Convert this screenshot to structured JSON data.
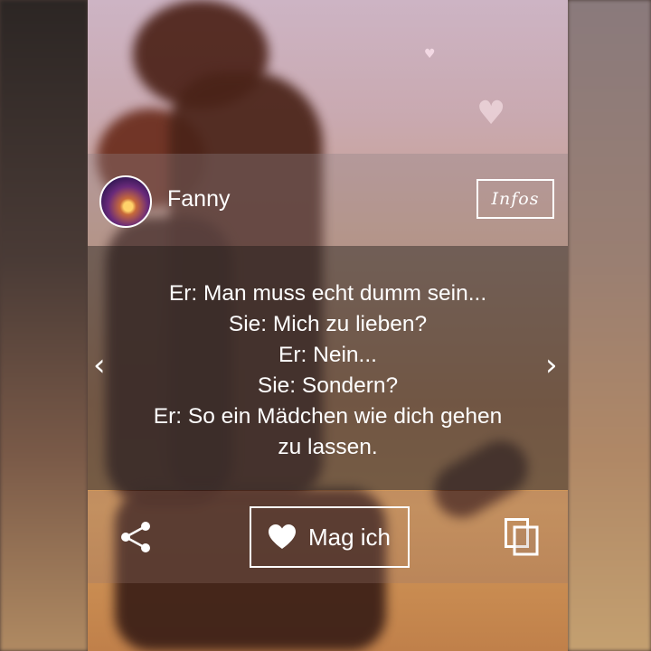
{
  "post": {
    "username": "Fanny",
    "infos_label": "Infos",
    "quote_lines": [
      "Er: Man muss echt dumm sein...",
      "Sie: Mich zu lieben?",
      "Er: Nein...",
      "Sie: Sondern?",
      "Er: So ein Mädchen wie dich gehen",
      "zu lassen."
    ]
  },
  "navigation": {
    "prev_symbol": "‹",
    "next_symbol": "›"
  },
  "actions": {
    "like_label": "Mag ich",
    "share_icon": "share-icon",
    "copy_icon": "copy-icon",
    "like_icon": "heart-icon"
  },
  "colors": {
    "text": "#ffffff",
    "panel": "#3c3737"
  }
}
